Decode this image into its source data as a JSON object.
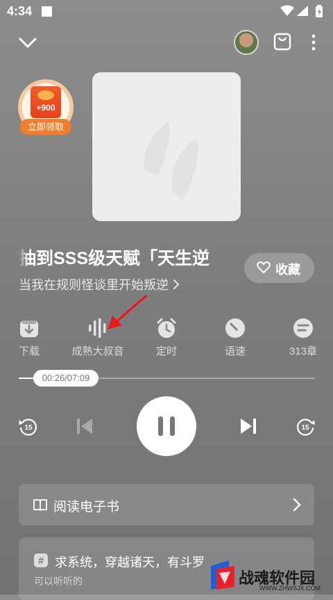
{
  "status_bar": {
    "time": "4:34"
  },
  "reward": {
    "amount": "+900",
    "claim_label": "立即领取"
  },
  "book": {
    "title": "抽到SSS级天赋「天生逆",
    "subtitle": "当我在规则怪谈里开始叛逆 ",
    "favorite_label": "收藏"
  },
  "actions": [
    {
      "label": "下载",
      "icon": "download-icon"
    },
    {
      "label": "成熟大叔音",
      "icon": "voice-wave-icon"
    },
    {
      "label": "定时",
      "icon": "alarm-icon"
    },
    {
      "label": "语速",
      "icon": "speed-gauge-icon"
    },
    {
      "label": "313章",
      "icon": "chapter-list-icon"
    }
  ],
  "player": {
    "time_display": "00:26/07:09",
    "progress": 0.06,
    "rewind_seconds": "15",
    "forward_seconds": "15"
  },
  "ebook": {
    "label": "阅读电子书"
  },
  "recommendation": {
    "title": "求系统，穿越诸天，有斗罗",
    "subtitle": "可以听听的"
  },
  "watermark": {
    "text": "战魂软件园",
    "url": "WWW.ZHWSJX.COM"
  },
  "colors": {
    "accent_orange": "#f27d2a",
    "arrow_red": "#e8191c"
  }
}
